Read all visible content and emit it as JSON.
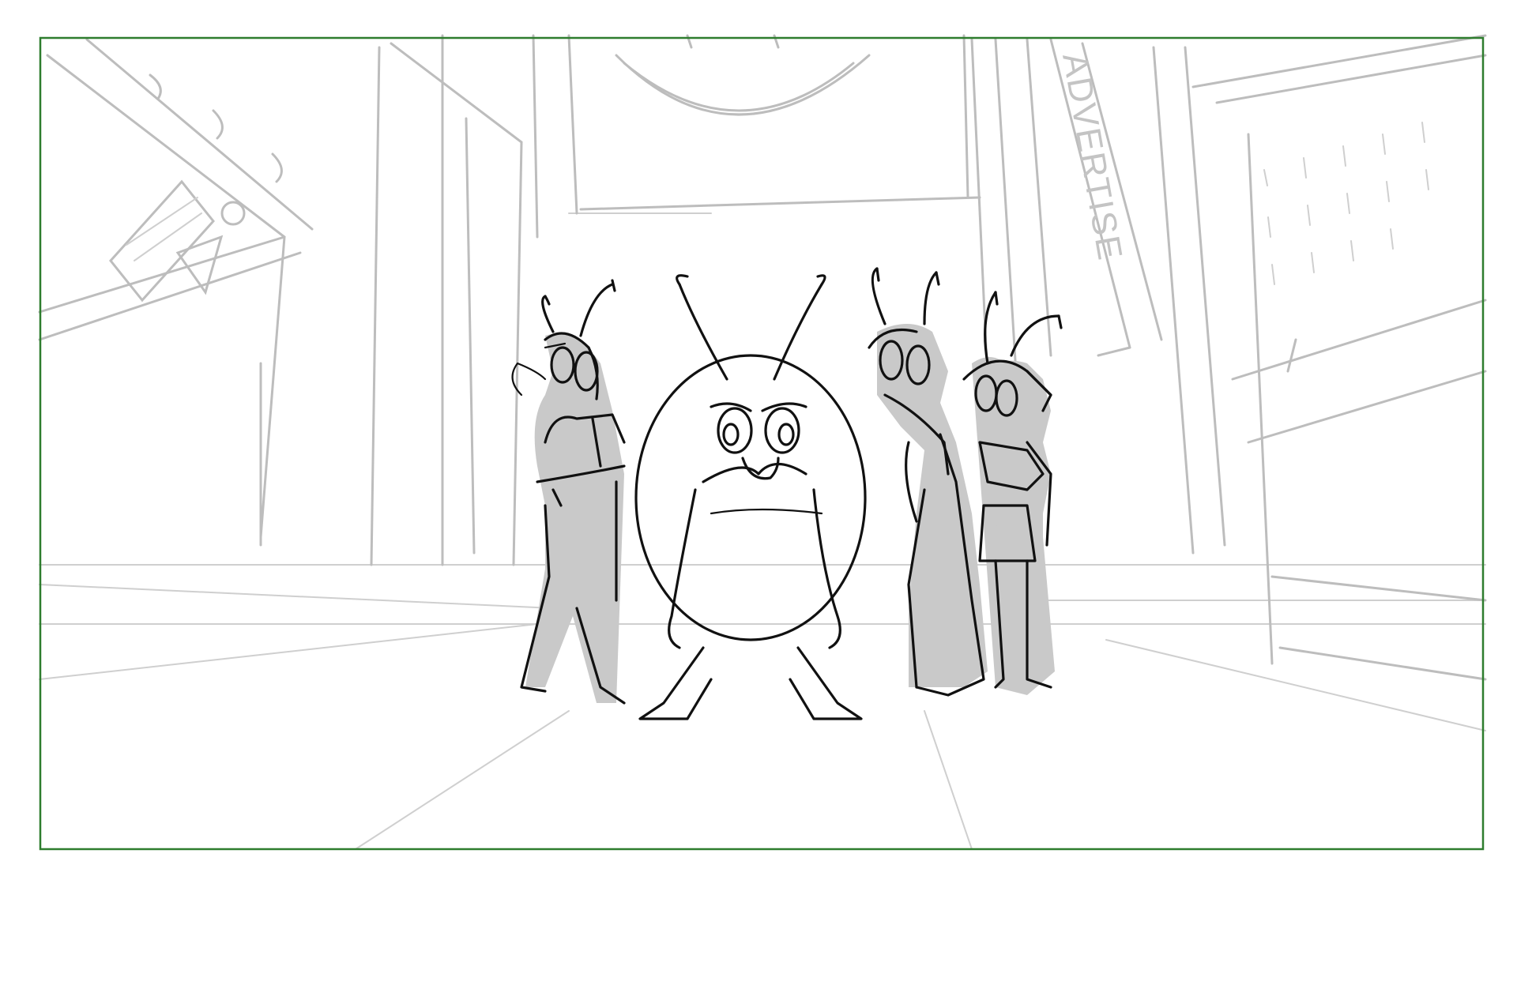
{
  "panel": {
    "frame_color": "#2e7d2e",
    "background_color": "#ffffff",
    "line_color": "#111111",
    "tone_color": "#c9c9c9",
    "background_line_color": "#bdbdbd"
  },
  "background": {
    "sign_text": "ADVERTISE"
  },
  "characters": [
    {
      "role": "leader",
      "description_icon": "round-bug-leader-icon"
    },
    {
      "role": "left-ant",
      "description_icon": "ant-arms-crossed-icon"
    },
    {
      "role": "right-ant-1",
      "description_icon": "ant-hand-on-hip-icon"
    },
    {
      "role": "right-ant-2",
      "description_icon": "ant-ponytail-icon"
    }
  ]
}
